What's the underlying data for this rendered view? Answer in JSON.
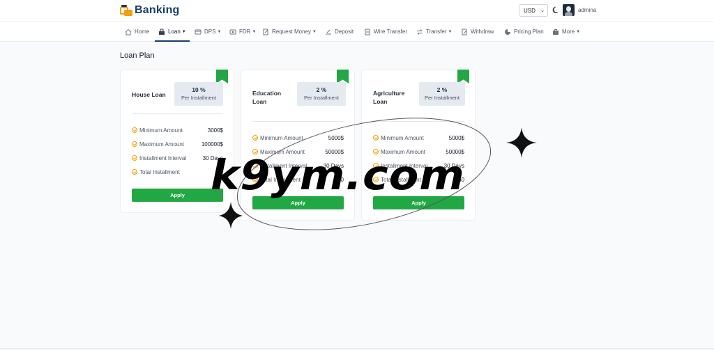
{
  "header": {
    "brand": "Banking",
    "currency": "USD",
    "username": "admina"
  },
  "nav": [
    {
      "label": "Home",
      "icon": "home-icon",
      "dropdown": false
    },
    {
      "label": "Loan",
      "icon": "loan-icon",
      "dropdown": true,
      "active": true
    },
    {
      "label": "DPS",
      "icon": "dps-icon",
      "dropdown": true
    },
    {
      "label": "FDR",
      "icon": "fdr-icon",
      "dropdown": true
    },
    {
      "label": "Request Money",
      "icon": "request-money-icon",
      "dropdown": true
    },
    {
      "label": "Deposit",
      "icon": "deposit-icon",
      "dropdown": false
    },
    {
      "label": "Wire Transfer",
      "icon": "wire-transfer-icon",
      "dropdown": false
    },
    {
      "label": "Transfer",
      "icon": "transfer-icon",
      "dropdown": true
    },
    {
      "label": "Withdraw",
      "icon": "withdraw-icon",
      "dropdown": false
    },
    {
      "label": "Pricing Plan",
      "icon": "pricing-plan-icon",
      "dropdown": false
    },
    {
      "label": "More",
      "icon": "more-icon",
      "dropdown": true
    }
  ],
  "page": {
    "title": "Loan Plan"
  },
  "plans": [
    {
      "name": "House Loan",
      "rate": "10 %",
      "rate_label": "Per Installment",
      "rows": [
        {
          "label": "Minimum Amount",
          "value": "3000$"
        },
        {
          "label": "Maximum Amount",
          "value": "100000$"
        },
        {
          "label": "Installment Interval",
          "value": "30 Days"
        },
        {
          "label": "Total Installment",
          "value": "10"
        }
      ],
      "apply": "Apply"
    },
    {
      "name": "Education Loan",
      "rate": "2 %",
      "rate_label": "Per Installment",
      "rows": [
        {
          "label": "Minimum Amount",
          "value": "5000$"
        },
        {
          "label": "Maximum Amount",
          "value": "50000$"
        },
        {
          "label": "Installment Interval",
          "value": "30 Days"
        },
        {
          "label": "Total Installment",
          "value": "60"
        }
      ],
      "apply": "Apply"
    },
    {
      "name": "Agriculture Loan",
      "rate": "2 %",
      "rate_label": "Per Installment",
      "rows": [
        {
          "label": "Minimum Amount",
          "value": "5000$"
        },
        {
          "label": "Maximum Amount",
          "value": "50000$"
        },
        {
          "label": "Installment Interval",
          "value": "30 Days"
        },
        {
          "label": "Total Installment",
          "value": "60"
        }
      ],
      "apply": "Apply"
    }
  ],
  "watermark": {
    "text": "k9ym.com"
  },
  "colors": {
    "brand": "#163e6e",
    "accent_green": "#22a745",
    "check_orange": "#f59e0b"
  }
}
